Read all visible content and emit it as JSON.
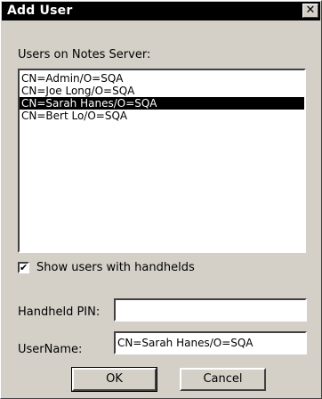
{
  "window": {
    "title": "Add User",
    "close_glyph": "✕"
  },
  "users_list": {
    "label": "Users on Notes Server:",
    "items": [
      {
        "label": "CN=Admin/O=SQA",
        "selected": false
      },
      {
        "label": "CN=Joe Long/O=SQA",
        "selected": false
      },
      {
        "label": "CN=Sarah Hanes/O=SQA",
        "selected": true
      },
      {
        "label": "CN=Bert Lo/O=SQA",
        "selected": false
      }
    ]
  },
  "show_handhelds": {
    "label": "Show users with handhelds",
    "checked": true,
    "check_glyph": "✔"
  },
  "handheld_pin": {
    "label": "Handheld PIN:",
    "value": ""
  },
  "username": {
    "label": "UserName:",
    "value": "CN=Sarah Hanes/O=SQA"
  },
  "buttons": {
    "ok": "OK",
    "cancel": "Cancel"
  },
  "colors": {
    "face": "#d4d0c8",
    "titlebar": "#000000",
    "selection": "#000000"
  },
  "icons": {
    "close": "close-icon",
    "check": "check-icon"
  }
}
